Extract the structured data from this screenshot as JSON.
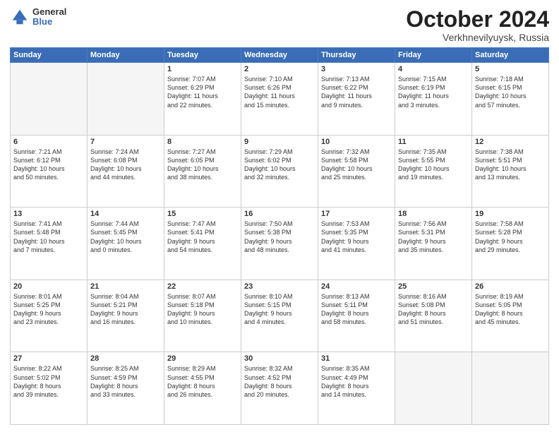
{
  "header": {
    "logo_general": "General",
    "logo_blue": "Blue",
    "month_title": "October 2024",
    "location": "Verkhnevilyuysk, Russia"
  },
  "days_of_week": [
    "Sunday",
    "Monday",
    "Tuesday",
    "Wednesday",
    "Thursday",
    "Friday",
    "Saturday"
  ],
  "weeks": [
    [
      {
        "day": "",
        "content": ""
      },
      {
        "day": "",
        "content": ""
      },
      {
        "day": "1",
        "content": "Sunrise: 7:07 AM\nSunset: 6:29 PM\nDaylight: 11 hours\nand 22 minutes."
      },
      {
        "day": "2",
        "content": "Sunrise: 7:10 AM\nSunset: 6:26 PM\nDaylight: 11 hours\nand 15 minutes."
      },
      {
        "day": "3",
        "content": "Sunrise: 7:13 AM\nSunset: 6:22 PM\nDaylight: 11 hours\nand 9 minutes."
      },
      {
        "day": "4",
        "content": "Sunrise: 7:15 AM\nSunset: 6:19 PM\nDaylight: 11 hours\nand 3 minutes."
      },
      {
        "day": "5",
        "content": "Sunrise: 7:18 AM\nSunset: 6:15 PM\nDaylight: 10 hours\nand 57 minutes."
      }
    ],
    [
      {
        "day": "6",
        "content": "Sunrise: 7:21 AM\nSunset: 6:12 PM\nDaylight: 10 hours\nand 50 minutes."
      },
      {
        "day": "7",
        "content": "Sunrise: 7:24 AM\nSunset: 6:08 PM\nDaylight: 10 hours\nand 44 minutes."
      },
      {
        "day": "8",
        "content": "Sunrise: 7:27 AM\nSunset: 6:05 PM\nDaylight: 10 hours\nand 38 minutes."
      },
      {
        "day": "9",
        "content": "Sunrise: 7:29 AM\nSunset: 6:02 PM\nDaylight: 10 hours\nand 32 minutes."
      },
      {
        "day": "10",
        "content": "Sunrise: 7:32 AM\nSunset: 5:58 PM\nDaylight: 10 hours\nand 25 minutes."
      },
      {
        "day": "11",
        "content": "Sunrise: 7:35 AM\nSunset: 5:55 PM\nDaylight: 10 hours\nand 19 minutes."
      },
      {
        "day": "12",
        "content": "Sunrise: 7:38 AM\nSunset: 5:51 PM\nDaylight: 10 hours\nand 13 minutes."
      }
    ],
    [
      {
        "day": "13",
        "content": "Sunrise: 7:41 AM\nSunset: 5:48 PM\nDaylight: 10 hours\nand 7 minutes."
      },
      {
        "day": "14",
        "content": "Sunrise: 7:44 AM\nSunset: 5:45 PM\nDaylight: 10 hours\nand 0 minutes."
      },
      {
        "day": "15",
        "content": "Sunrise: 7:47 AM\nSunset: 5:41 PM\nDaylight: 9 hours\nand 54 minutes."
      },
      {
        "day": "16",
        "content": "Sunrise: 7:50 AM\nSunset: 5:38 PM\nDaylight: 9 hours\nand 48 minutes."
      },
      {
        "day": "17",
        "content": "Sunrise: 7:53 AM\nSunset: 5:35 PM\nDaylight: 9 hours\nand 41 minutes."
      },
      {
        "day": "18",
        "content": "Sunrise: 7:56 AM\nSunset: 5:31 PM\nDaylight: 9 hours\nand 35 minutes."
      },
      {
        "day": "19",
        "content": "Sunrise: 7:58 AM\nSunset: 5:28 PM\nDaylight: 9 hours\nand 29 minutes."
      }
    ],
    [
      {
        "day": "20",
        "content": "Sunrise: 8:01 AM\nSunset: 5:25 PM\nDaylight: 9 hours\nand 23 minutes."
      },
      {
        "day": "21",
        "content": "Sunrise: 8:04 AM\nSunset: 5:21 PM\nDaylight: 9 hours\nand 16 minutes."
      },
      {
        "day": "22",
        "content": "Sunrise: 8:07 AM\nSunset: 5:18 PM\nDaylight: 9 hours\nand 10 minutes."
      },
      {
        "day": "23",
        "content": "Sunrise: 8:10 AM\nSunset: 5:15 PM\nDaylight: 9 hours\nand 4 minutes."
      },
      {
        "day": "24",
        "content": "Sunrise: 8:13 AM\nSunset: 5:11 PM\nDaylight: 8 hours\nand 58 minutes."
      },
      {
        "day": "25",
        "content": "Sunrise: 8:16 AM\nSunset: 5:08 PM\nDaylight: 8 hours\nand 51 minutes."
      },
      {
        "day": "26",
        "content": "Sunrise: 8:19 AM\nSunset: 5:05 PM\nDaylight: 8 hours\nand 45 minutes."
      }
    ],
    [
      {
        "day": "27",
        "content": "Sunrise: 8:22 AM\nSunset: 5:02 PM\nDaylight: 8 hours\nand 39 minutes."
      },
      {
        "day": "28",
        "content": "Sunrise: 8:25 AM\nSunset: 4:59 PM\nDaylight: 8 hours\nand 33 minutes."
      },
      {
        "day": "29",
        "content": "Sunrise: 8:29 AM\nSunset: 4:55 PM\nDaylight: 8 hours\nand 26 minutes."
      },
      {
        "day": "30",
        "content": "Sunrise: 8:32 AM\nSunset: 4:52 PM\nDaylight: 8 hours\nand 20 minutes."
      },
      {
        "day": "31",
        "content": "Sunrise: 8:35 AM\nSunset: 4:49 PM\nDaylight: 8 hours\nand 14 minutes."
      },
      {
        "day": "",
        "content": ""
      },
      {
        "day": "",
        "content": ""
      }
    ]
  ]
}
